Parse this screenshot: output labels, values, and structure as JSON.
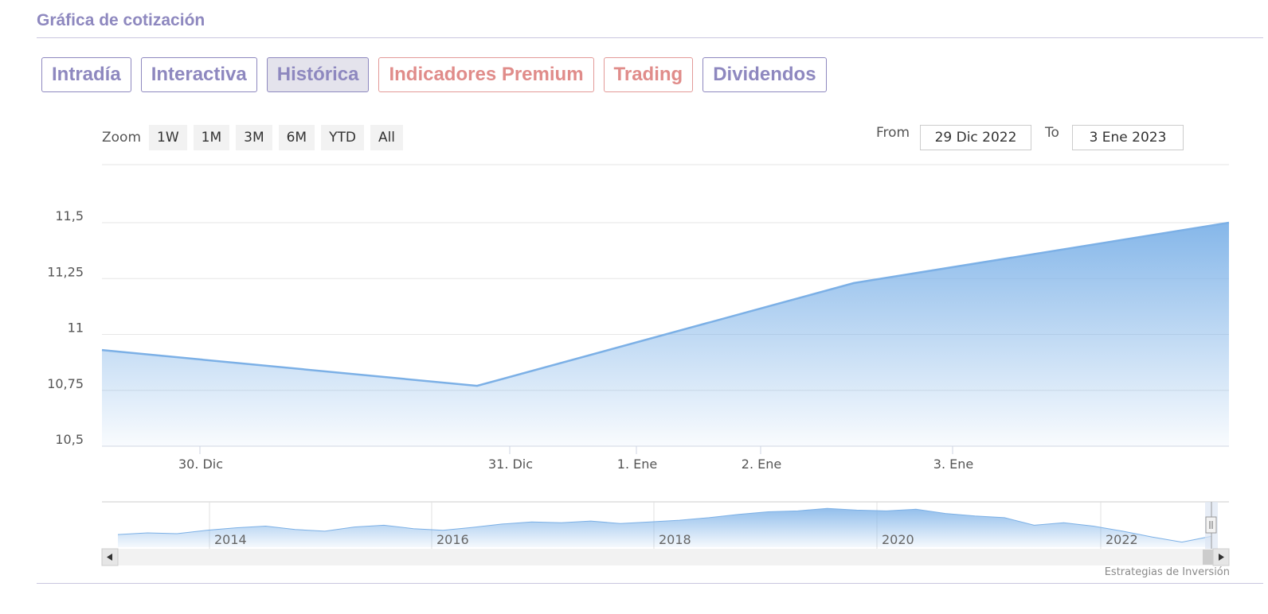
{
  "header": {
    "title": "Gráfica de cotización"
  },
  "tabs": [
    {
      "label": "Intradía",
      "active": false,
      "premium": false
    },
    {
      "label": "Interactiva",
      "active": false,
      "premium": false
    },
    {
      "label": "Histórica",
      "active": true,
      "premium": false
    },
    {
      "label": "Indicadores Premium",
      "active": false,
      "premium": true
    },
    {
      "label": "Trading",
      "active": false,
      "premium": true
    },
    {
      "label": "Dividendos",
      "active": false,
      "premium": false
    }
  ],
  "zoom": {
    "label": "Zoom",
    "buttons": [
      "1W",
      "1M",
      "3M",
      "6M",
      "YTD",
      "All"
    ]
  },
  "range": {
    "from_label": "From",
    "from_value": "29 Dic 2022",
    "to_label": "To",
    "to_value": "3 Ene 2023"
  },
  "credits": "Estrategias de Inversión",
  "colors": {
    "accent": "#8e88bf",
    "premium": "#e08c8a",
    "series_line": "#7cb0e6",
    "series_fill": "#8dbce9"
  },
  "chart_data": {
    "type": "area",
    "title": "",
    "xlabel": "",
    "ylabel": "",
    "ylim": [
      10.5,
      11.5
    ],
    "yticks": [
      "10,5",
      "10,75",
      "11",
      "11,25",
      "11,5"
    ],
    "x_ticks": [
      "30. Dic",
      "31. Dic",
      "1. Ene",
      "2. Ene",
      "3. Ene"
    ],
    "series": [
      {
        "x": [
          "30. Dic",
          "31. Dic",
          "2. Ene",
          "3. Ene"
        ],
        "values": [
          10.93,
          10.77,
          11.23,
          11.5
        ]
      }
    ],
    "navigator": {
      "year_labels": [
        "2014",
        "2016",
        "2018",
        "2020",
        "2022"
      ],
      "values": [
        0.3,
        0.34,
        0.32,
        0.4,
        0.46,
        0.5,
        0.42,
        0.38,
        0.48,
        0.52,
        0.44,
        0.4,
        0.47,
        0.55,
        0.6,
        0.58,
        0.62,
        0.56,
        0.6,
        0.64,
        0.7,
        0.78,
        0.84,
        0.86,
        0.92,
        0.88,
        0.86,
        0.9,
        0.8,
        0.74,
        0.7,
        0.52,
        0.58,
        0.5,
        0.38,
        0.24,
        0.12,
        0.26
      ]
    }
  }
}
